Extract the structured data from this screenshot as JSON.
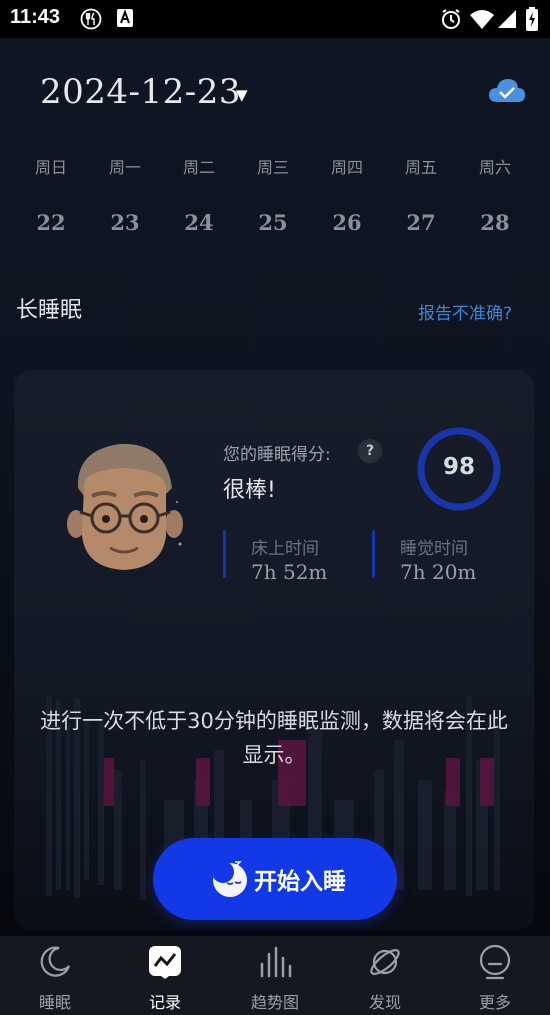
{
  "status_bar": {
    "time": "11:43"
  },
  "header": {
    "date": "2024-12-23"
  },
  "week": {
    "weekdays": [
      "周日",
      "周一",
      "周二",
      "周三",
      "周四",
      "周五",
      "周六"
    ],
    "days": [
      "22",
      "23",
      "24",
      "25",
      "26",
      "27",
      "28"
    ]
  },
  "section": {
    "title": "长睡眠",
    "report_link": "报告不准确?"
  },
  "card": {
    "score_label": "您的睡眠得分:",
    "help": "?",
    "score_text": "很棒!",
    "score_value": "98",
    "score_fraction": 0.98,
    "metrics": [
      {
        "label": "床上时间",
        "value": "7h 52m"
      },
      {
        "label": "睡觉时间",
        "value": "7h 20m"
      }
    ],
    "empty_message": "进行一次不低于30分钟的睡眠监测，数据将会在此显示。"
  },
  "start_button": {
    "label": "开始入睡"
  },
  "tabs": [
    {
      "label": "睡眠",
      "icon": "moon-icon",
      "active": false
    },
    {
      "label": "记录",
      "icon": "chart-icon",
      "active": true
    },
    {
      "label": "趋势图",
      "icon": "bars-icon",
      "active": false
    },
    {
      "label": "发现",
      "icon": "planet-icon",
      "active": false
    },
    {
      "label": "更多",
      "icon": "face-icon",
      "active": false
    }
  ],
  "colors": {
    "accent": "#1338e6",
    "link": "#3f86d8",
    "ring": "#1a35a8",
    "chart_magenta": "#5a1540"
  }
}
